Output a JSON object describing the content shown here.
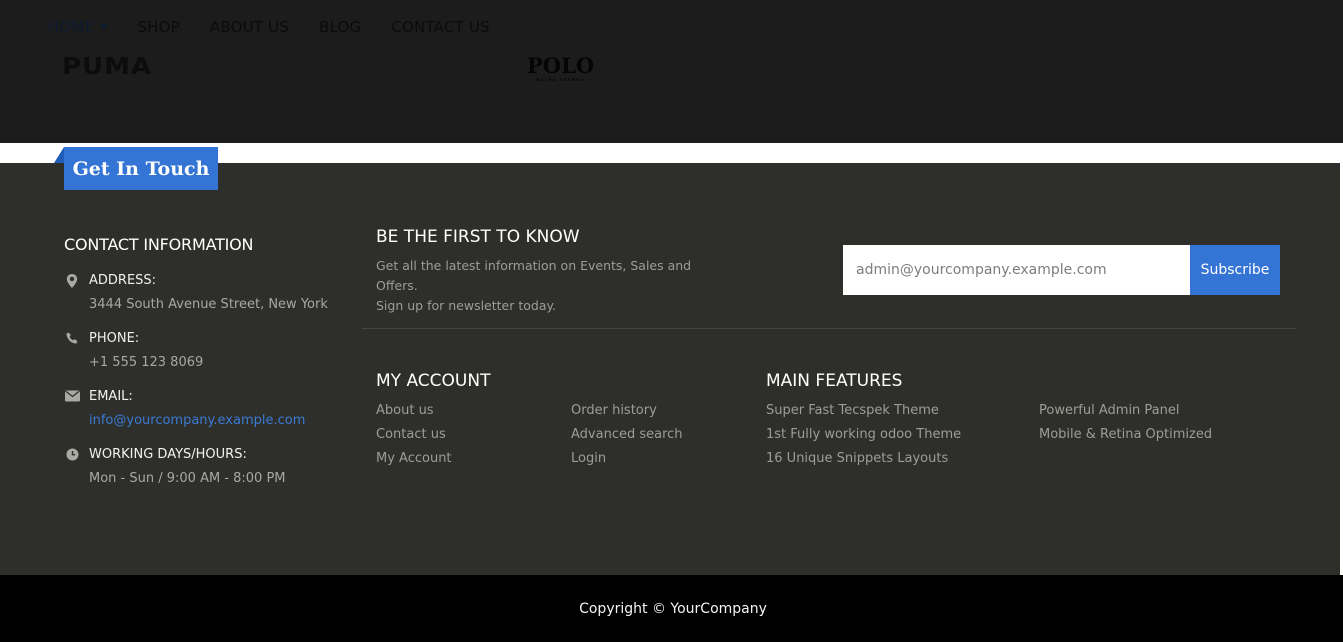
{
  "nav": {
    "items": [
      {
        "label": "HOME",
        "active": true,
        "dropdown": true
      },
      {
        "label": "SHOP"
      },
      {
        "label": "ABOUT US"
      },
      {
        "label": "BLOG"
      },
      {
        "label": "CONTACT US"
      }
    ]
  },
  "brands": {
    "logo1": "PUMA",
    "logo2_main": "POLO",
    "logo2_sub": "RALPH LAUREN"
  },
  "footer": {
    "tab_label": "Get In Touch",
    "contact": {
      "title": "CONTACT INFORMATION",
      "items": [
        {
          "icon": "map-marker-icon",
          "label": "ADDRESS:",
          "value": "3444 South Avenue Street, New York"
        },
        {
          "icon": "phone-icon",
          "label": "PHONE:",
          "value": "+1 555 123 8069"
        },
        {
          "icon": "envelope-icon",
          "label": "EMAIL:",
          "value": "info@yourcompany.example.com"
        },
        {
          "icon": "clock-icon",
          "label": "WORKING DAYS/HOURS:",
          "value": "Mon - Sun / 9:00 AM - 8:00 PM"
        }
      ]
    },
    "newsletter": {
      "title": "BE THE FIRST TO KNOW",
      "line1": "Get all the latest information on Events, Sales and Offers.",
      "line2": "Sign up for newsletter today.",
      "email_placeholder": "admin@yourcompany.example.com",
      "subscribe_label": "Subscribe"
    },
    "my_account": {
      "title": "MY ACCOUNT",
      "col1": [
        "About us",
        "Contact us",
        "My Account"
      ],
      "col2": [
        "Order history",
        "Advanced search",
        "Login"
      ]
    },
    "main_features": {
      "title": "MAIN FEATURES",
      "col1": [
        "Super Fast Tecspek Theme",
        "1st Fully working odoo Theme",
        "16 Unique Snippets Layouts"
      ],
      "col2": [
        "Powerful Admin Panel",
        "Mobile & Retina Optimized"
      ]
    },
    "copyright": "Copyright © YourCompany"
  },
  "colors": {
    "accent": "#3474d4",
    "footer_bg": "#2e2e2a",
    "top_band": "#1c1c1c",
    "bottom_bar": "#000000",
    "link": "#3a7bd5"
  }
}
